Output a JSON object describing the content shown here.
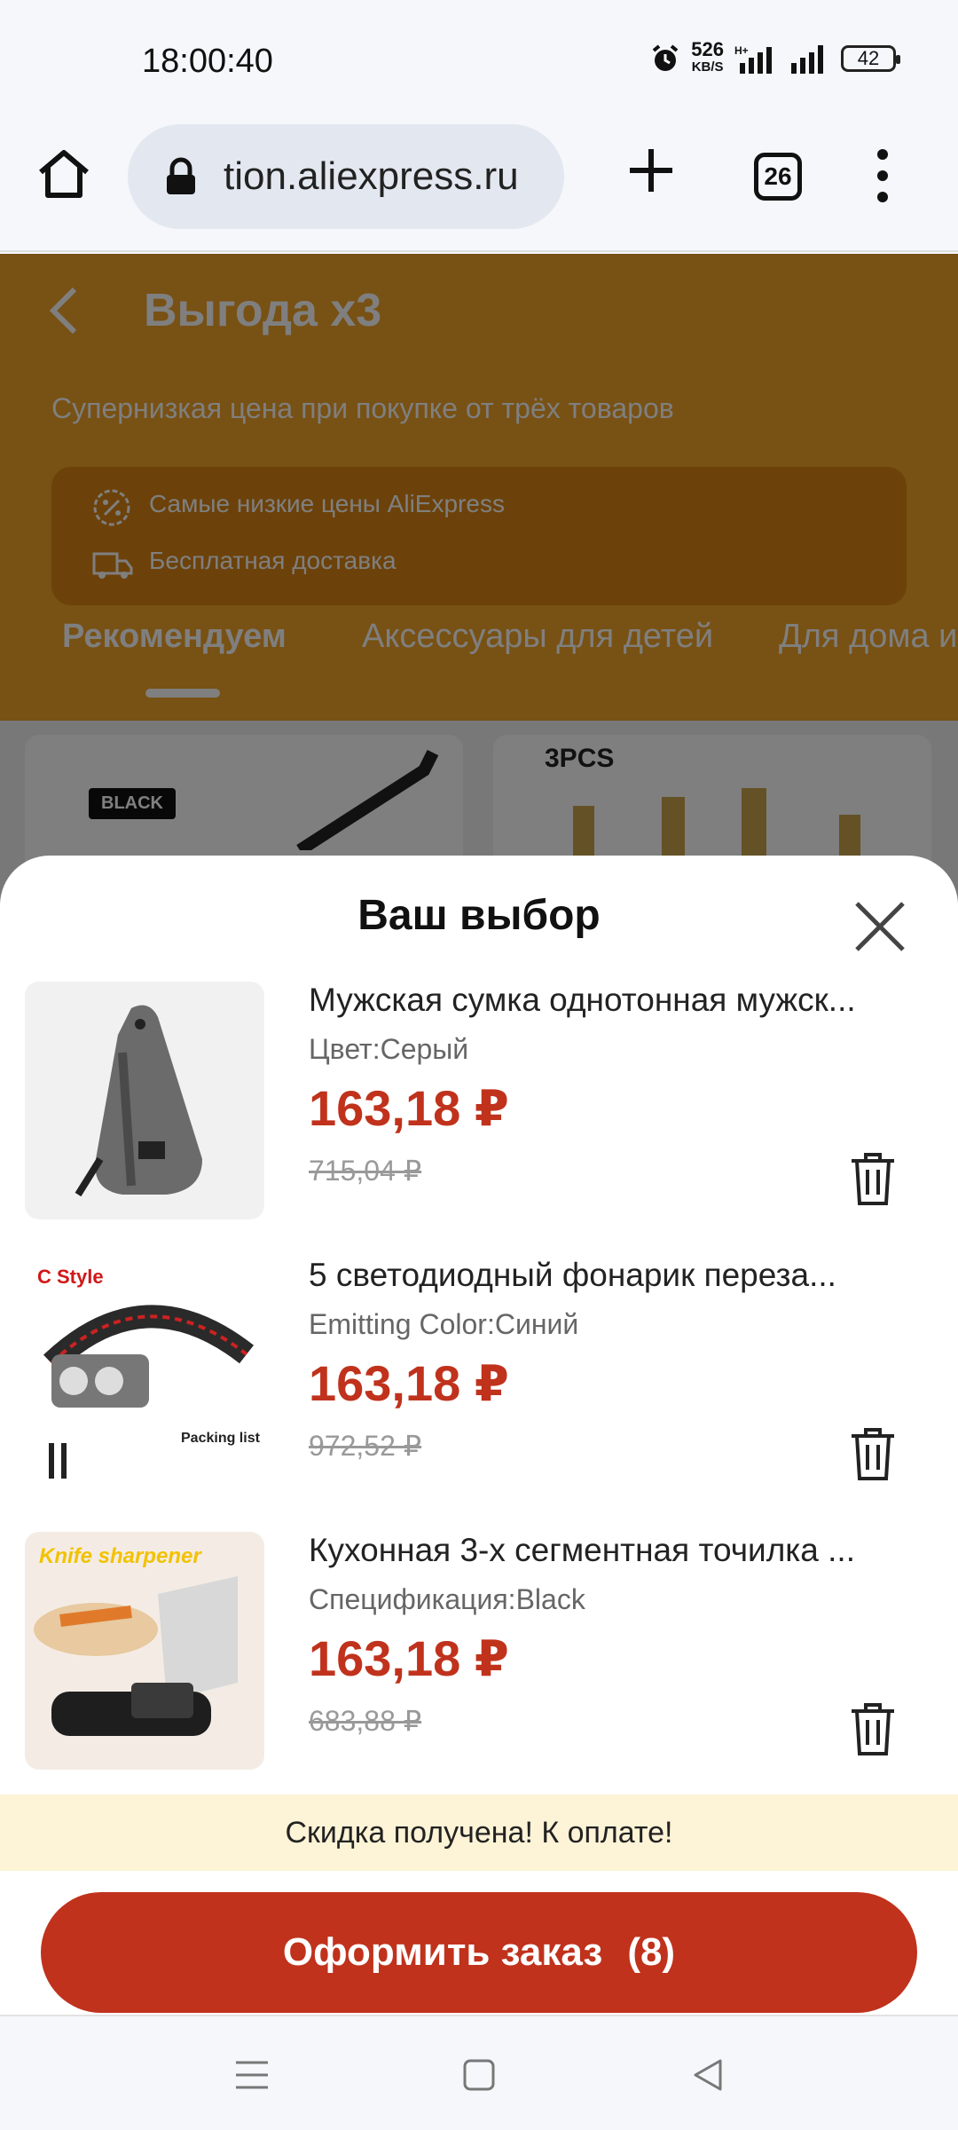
{
  "status_bar": {
    "time": "18:00:40",
    "network_speed": "526",
    "network_speed_unit": "KB/S",
    "battery": "42"
  },
  "browser": {
    "url": "tion.aliexpress.ru",
    "tab_count": "26"
  },
  "page": {
    "title": "Выгода х3",
    "subtitle": "Супернизкая цена при покупке от трёх товаров",
    "benefits": [
      "Самые низкие цены AliExpress",
      "Бесплатная доставка"
    ],
    "categories": [
      "Рекомендуем",
      "Аксессуары для детей",
      "Для дома и"
    ],
    "product_labels": [
      "BLACK",
      "3PCS"
    ]
  },
  "sheet": {
    "title": "Ваш выбор",
    "items": [
      {
        "title": "Мужская сумка однотонная мужск...",
        "variant": "Цвет:Серый",
        "price": "163,18 ₽",
        "old_price": "715,04 ₽"
      },
      {
        "title": "5 светодиодный фонарик переза...",
        "variant": "Emitting Color:Синий",
        "price": "163,18 ₽",
        "old_price": "972,52 ₽",
        "thumb_text": [
          "C Style",
          "Packing list"
        ]
      },
      {
        "title": "Кухонная 3-х сегментная точилка ...",
        "variant": "Спецификация:Black",
        "price": "163,18 ₽",
        "old_price": "683,88 ₽",
        "thumb_text": [
          "Knife sharpener"
        ]
      }
    ],
    "banner": "Скидка получена! К оплате!",
    "checkout_label": "Оформить заказ",
    "checkout_count": "(8)"
  },
  "colors": {
    "accent": "#c0321c",
    "promo_bg": "#f0a229",
    "banner_bg": "#fdf3d6"
  }
}
